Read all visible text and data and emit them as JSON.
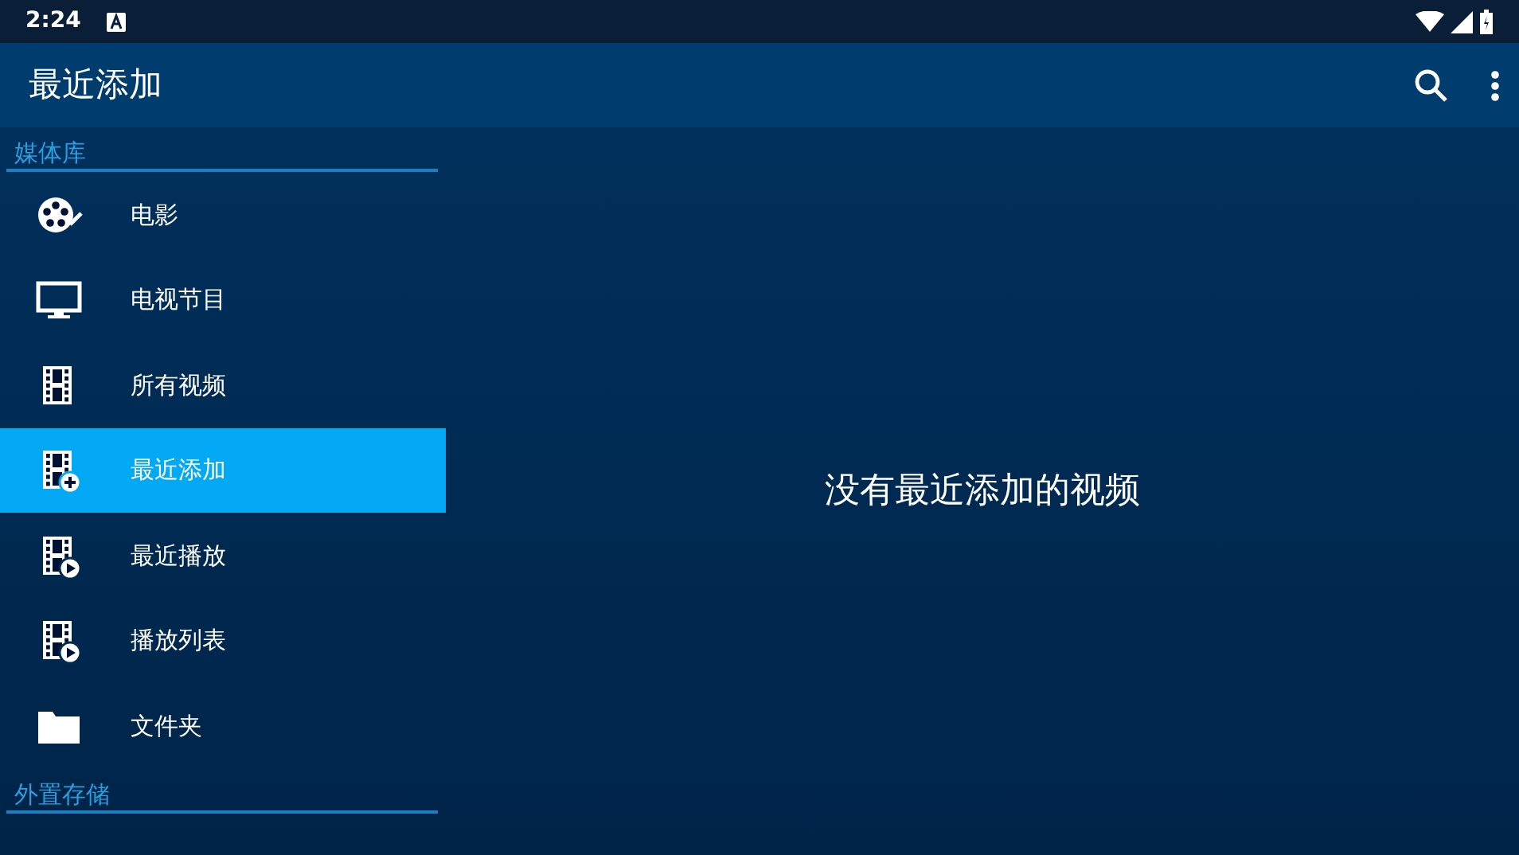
{
  "status_bar": {
    "time": "2:24"
  },
  "app_bar": {
    "title": "最近添加"
  },
  "sidebar": {
    "sections": [
      {
        "header": "媒体库",
        "items": [
          {
            "label": "电影",
            "kind": "reel",
            "selected": false
          },
          {
            "label": "电视节目",
            "kind": "tv",
            "selected": false
          },
          {
            "label": "所有视频",
            "kind": "film",
            "selected": false
          },
          {
            "label": "最近添加",
            "kind": "film-plus",
            "selected": true
          },
          {
            "label": "最近播放",
            "kind": "film-play",
            "selected": false
          },
          {
            "label": "播放列表",
            "kind": "film-play",
            "selected": false
          },
          {
            "label": "文件夹",
            "kind": "folder",
            "selected": false
          }
        ]
      },
      {
        "header": "外置存储"
      }
    ]
  },
  "content": {
    "empty_message": "没有最近添加的视频"
  }
}
